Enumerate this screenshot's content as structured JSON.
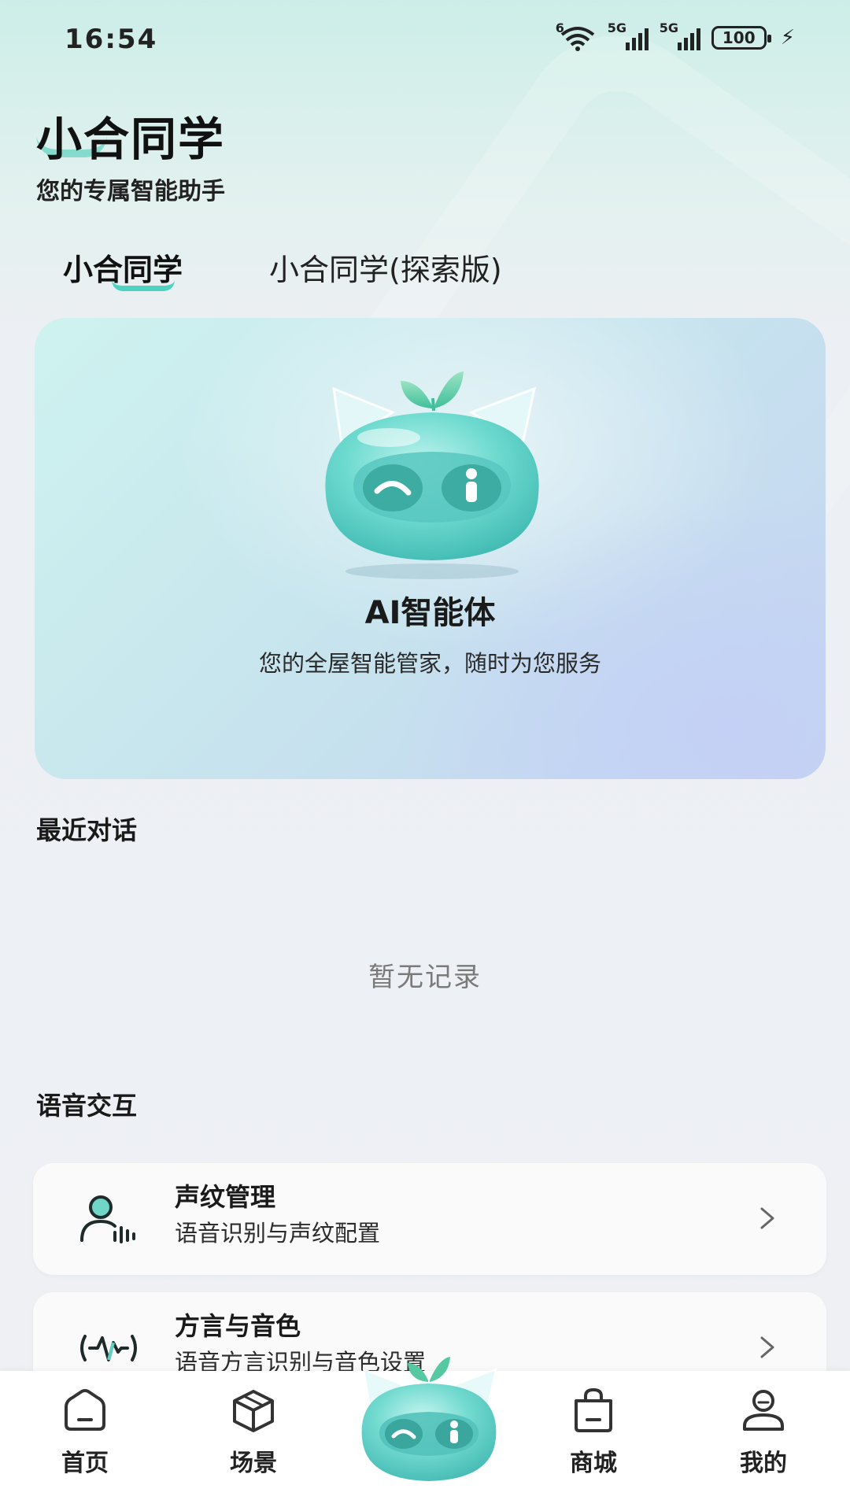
{
  "status_bar": {
    "time": "16:54",
    "wifi_tag": "6",
    "sim1_tag": "5G",
    "sim2_tag": "5G",
    "battery": "100",
    "icons": [
      "wifi-icon",
      "signal-icon",
      "signal-icon",
      "battery-icon",
      "charging-icon"
    ]
  },
  "header": {
    "title": "小合同学",
    "subtitle": "您的专属智能助手"
  },
  "tabs": [
    {
      "label": "小合同学",
      "active": true
    },
    {
      "label": "小合同学(探索版)",
      "active": false
    }
  ],
  "hero": {
    "title": "AI智能体",
    "description": "您的全屋智能管家，随时为您服务"
  },
  "recent": {
    "title": "最近对话",
    "empty_text": "暂无记录"
  },
  "voice": {
    "title": "语音交互",
    "items": [
      {
        "title": "声纹管理",
        "subtitle": "语音识别与声纹配置",
        "icon": "voiceprint-icon"
      },
      {
        "title": "方言与音色",
        "subtitle": "语音方言识别与音色设置",
        "icon": "waveform-icon"
      }
    ]
  },
  "bottom_nav": {
    "items": [
      {
        "label": "首页",
        "icon": "home-icon"
      },
      {
        "label": "场景",
        "icon": "cube-icon"
      },
      {
        "label": "商城",
        "icon": "shopping-bag-icon"
      },
      {
        "label": "我的",
        "icon": "profile-icon"
      }
    ]
  },
  "colors": {
    "accent": "#4fd2c1",
    "mascot": "#5fd3c8",
    "background": "#eef0f4",
    "card": "#fafafa"
  }
}
